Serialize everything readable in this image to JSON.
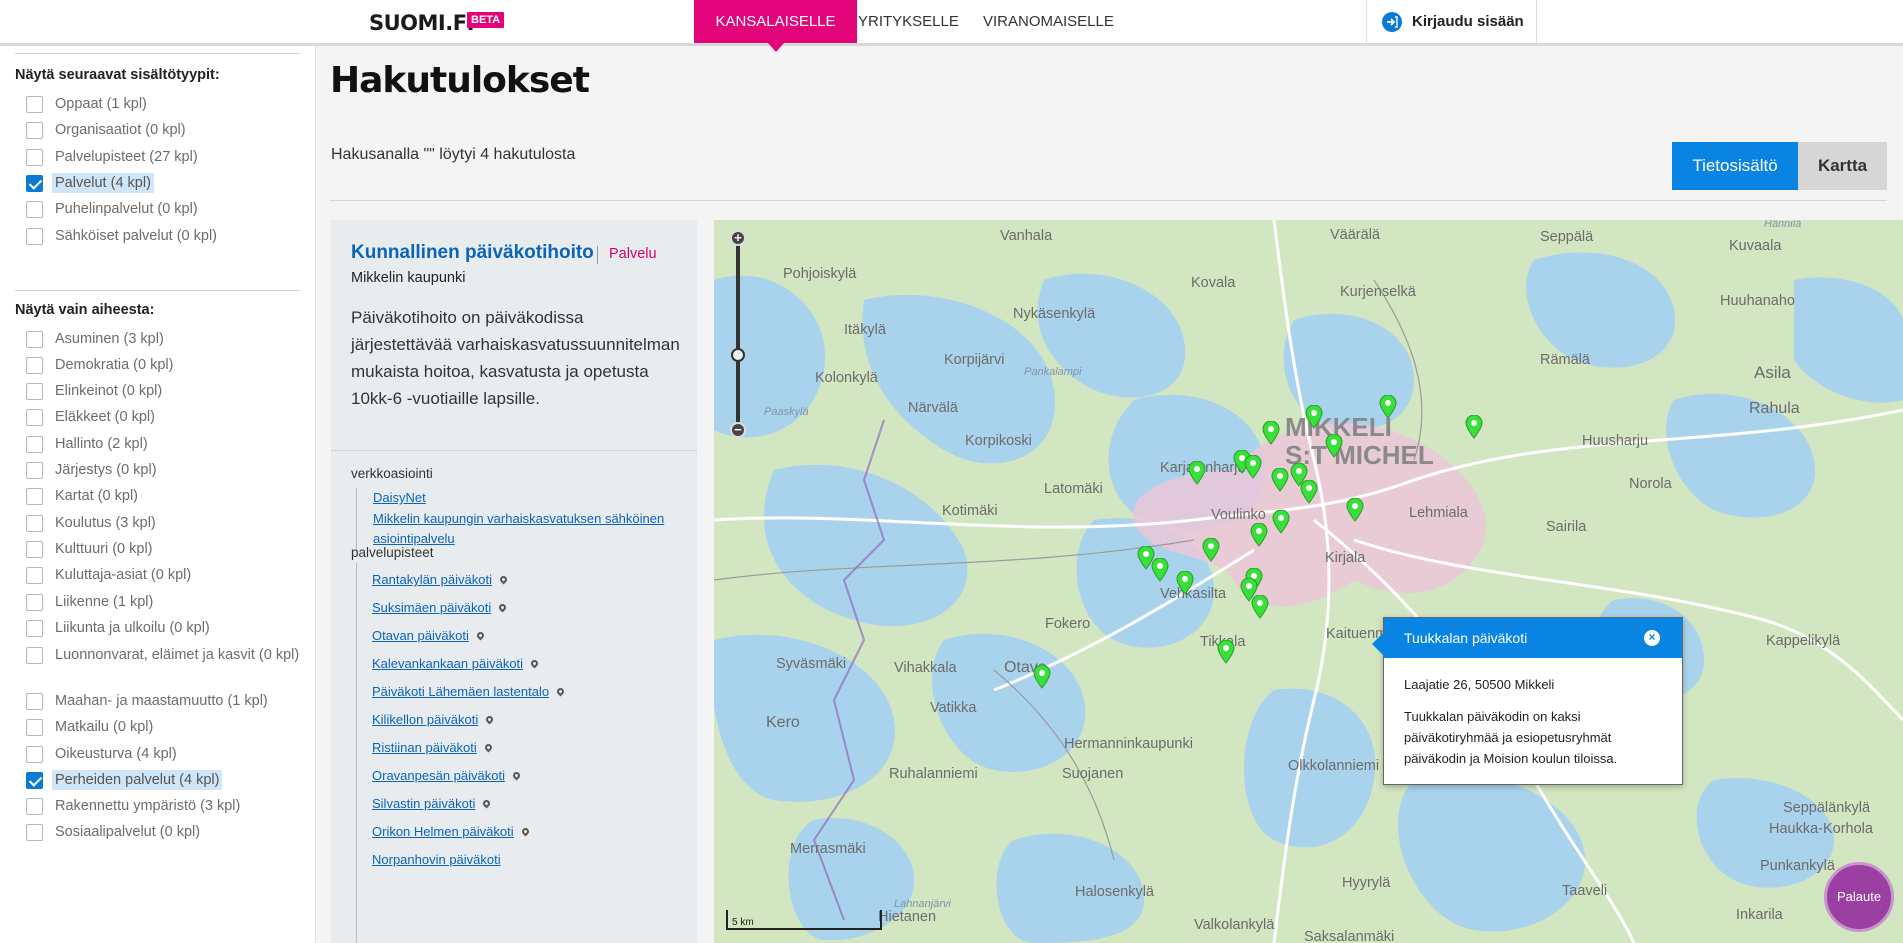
{
  "header": {
    "logo": "SUOMI.FI",
    "beta_badge": "BETA",
    "nav_tabs": [
      {
        "label": "KANSALAISELLE",
        "active": true
      },
      {
        "label": "YRITYKSELLE",
        "active": false
      },
      {
        "label": "VIRANOMAISELLE",
        "active": false
      }
    ],
    "login_label": "Kirjaudu sisään"
  },
  "sidebar": {
    "content_types_heading": "Näytä seuraavat sisältötyypit:",
    "content_types": [
      {
        "label": "Oppaat (1 kpl)",
        "checked": false
      },
      {
        "label": "Organisaatiot (0 kpl)",
        "checked": false
      },
      {
        "label": "Palvelupisteet (27 kpl)",
        "checked": false
      },
      {
        "label": "Palvelut (4 kpl)",
        "checked": true
      },
      {
        "label": "Puhelinpalvelut (0 kpl)",
        "checked": false
      },
      {
        "label": "Sähköiset palvelut (0 kpl)",
        "checked": false
      }
    ],
    "topics_heading": "Näytä vain aiheesta:",
    "topics": [
      {
        "label": "Asuminen (3 kpl)",
        "checked": false
      },
      {
        "label": "Demokratia (0 kpl)",
        "checked": false
      },
      {
        "label": "Elinkeinot (0 kpl)",
        "checked": false
      },
      {
        "label": "Eläkkeet (0 kpl)",
        "checked": false
      },
      {
        "label": "Hallinto (2 kpl)",
        "checked": false
      },
      {
        "label": "Järjestys (0 kpl)",
        "checked": false
      },
      {
        "label": "Kartat (0 kpl)",
        "checked": false
      },
      {
        "label": "Koulutus (3 kpl)",
        "checked": false
      },
      {
        "label": "Kulttuuri (0 kpl)",
        "checked": false
      },
      {
        "label": "Kuluttaja-asiat (0 kpl)",
        "checked": false
      },
      {
        "label": "Liikenne (1 kpl)",
        "checked": false
      },
      {
        "label": "Liikunta ja ulkoilu (0 kpl)",
        "checked": false
      },
      {
        "label": "Luonnonvarat, eläimet ja kasvit (0 kpl)",
        "checked": false
      },
      {
        "label": "Maahan- ja maastamuutto (1 kpl)",
        "checked": false
      },
      {
        "label": "Matkailu (0 kpl)",
        "checked": false
      },
      {
        "label": "Oikeusturva (4 kpl)",
        "checked": false
      },
      {
        "label": "Perheiden palvelut (4 kpl)",
        "checked": true
      },
      {
        "label": "Rakennettu ympäristö (3 kpl)",
        "checked": false
      },
      {
        "label": "Sosiaalipalvelut (0 kpl)",
        "checked": false
      }
    ]
  },
  "main": {
    "title": "Hakutulokset",
    "result_count": "Hakusanalla \"\" löytyi 4 hakutulosta",
    "view_toggle": {
      "content": "Tietosisältö",
      "map": "Kartta",
      "active": "content"
    }
  },
  "result": {
    "title": "Kunnallinen päiväkotihoito",
    "type": "Palvelu",
    "organization": "Mikkelin kaupunki",
    "description": "Päiväkotihoito on päiväkodissa järjestettävää varhaiskasvatussuunnitelman mukaista hoitoa, kasvatusta ja opetusta 10kk-6 -vuotiaille lapsille.",
    "online_heading": "verkkoasiointi",
    "online_links": [
      "DaisyNet",
      "Mikkelin kaupungin varhaiskasvatuksen sähköinen asiointipalvelu"
    ],
    "locations_heading": "palvelupisteet",
    "locations": [
      "Rantakylän päiväkoti",
      "Suksimäen päiväkoti",
      "Otavan päiväkoti",
      "Kalevankankaan päiväkoti",
      "Päiväkoti Lähemäen lastentalo",
      "Kilikellon päiväkoti",
      "Ristiinan päiväkoti",
      "Oravanpesän päiväkoti",
      "Silvastin päiväkoti",
      "Orikon Helmen päiväkoti",
      "Norpanhovin päiväkoti"
    ]
  },
  "map": {
    "city_label": "MIKKELI\nS:T MICHEL",
    "place_labels": [
      "Vanhala",
      "Väärälä",
      "Seppälä",
      "Kuvaala",
      "Hännilä",
      "Pohjoiskylä",
      "Kovala",
      "Kurjenselkä",
      "Nykäsenkylä",
      "Huuhanaho",
      "Itäkylä",
      "Rämälä",
      "Korpijärvi",
      "Pankalampi",
      "Asila",
      "Kolonkylä",
      "Närvälä",
      "Paaskylä",
      "Rahula",
      "Huusharju",
      "Korpikoski",
      "Karjalanharju",
      "Norola",
      "Latomäki",
      "Kotimäki",
      "Voulinko",
      "Lehmiala",
      "Sairila",
      "Kirjala",
      "Vehkasilta",
      "Fokero",
      "Tikkala",
      "Kaituenmäki",
      "Syväsmäki",
      "Otava",
      "Vihakkala",
      "Kero",
      "Hermanninkaupunki",
      "Ruhalanniemi",
      "Olkkolanniemi",
      "Suojanen",
      "Merrasmäki",
      "Taaveli",
      "Haukka-Korhola",
      "Punkankylä",
      "Kappelikylä",
      "Seppälänkylä",
      "Hyyrylä",
      "Halosenkylä",
      "Hietanen",
      "Valkolankylä",
      "Inkarila",
      "Vatikka",
      "Saksalanmäki",
      "Lahnanjärvi"
    ],
    "scale_label": "5 km",
    "zoom_in": "+",
    "zoom_out": "−",
    "popup": {
      "title": "Tuukkalan päiväkoti",
      "address": "Laajatie 26, 50500 Mikkeli",
      "description": "Tuukkalan päiväkodin on kaksi päiväkotiryhmää ja esiopetusryhmät päiväkodin ja Moision koulun tiloissa."
    }
  },
  "feedback_label": "Palaute",
  "colors": {
    "brand_pink": "#e10579",
    "accent_blue": "#0a84e3",
    "marker_green": "#39e03a",
    "feedback_purple": "#9b3fa3"
  }
}
